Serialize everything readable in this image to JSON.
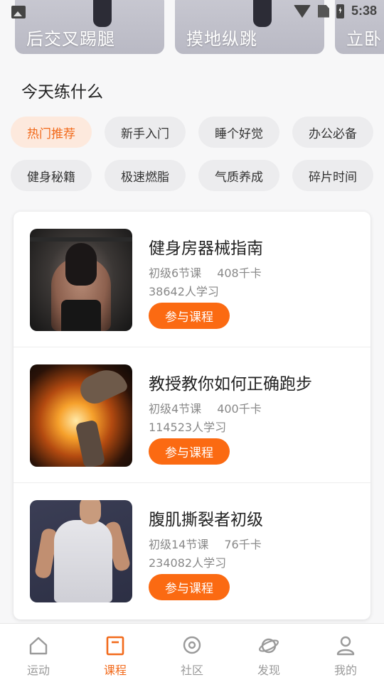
{
  "status_bar": {
    "time": "5:38"
  },
  "banners": [
    {
      "title": "后交叉踢腿"
    },
    {
      "title": "摸地纵跳"
    },
    {
      "title": "立卧"
    }
  ],
  "section": {
    "title": "今天练什么"
  },
  "categories": [
    {
      "label": "热门推荐",
      "active": true
    },
    {
      "label": "新手入门"
    },
    {
      "label": "睡个好觉"
    },
    {
      "label": "办公必备"
    },
    {
      "label": "健身秘籍"
    },
    {
      "label": "极速燃脂"
    },
    {
      "label": "气质养成"
    },
    {
      "label": "碎片时间"
    }
  ],
  "courses": [
    {
      "title": "健身房器械指南",
      "level": "初级6节课",
      "calories": "408千卡",
      "learners": "38642人学习",
      "button": "参与课程"
    },
    {
      "title": "教授教你如何正确跑步",
      "level": "初级4节课",
      "calories": "400千卡",
      "learners": "114523人学习",
      "button": "参与课程"
    },
    {
      "title": "腹肌撕裂者初级",
      "level": "初级14节课",
      "calories": "76千卡",
      "learners": "234082人学习",
      "button": "参与课程"
    }
  ],
  "bottom_nav": [
    {
      "label": "运动",
      "icon": "house-icon"
    },
    {
      "label": "课程",
      "icon": "course-icon",
      "active": true
    },
    {
      "label": "社区",
      "icon": "community-icon"
    },
    {
      "label": "发现",
      "icon": "planet-icon"
    },
    {
      "label": "我的",
      "icon": "person-icon"
    }
  ],
  "colors": {
    "accent": "#fb6a12",
    "chip_active_bg": "#fde9dd",
    "chip_bg": "#ececee"
  }
}
